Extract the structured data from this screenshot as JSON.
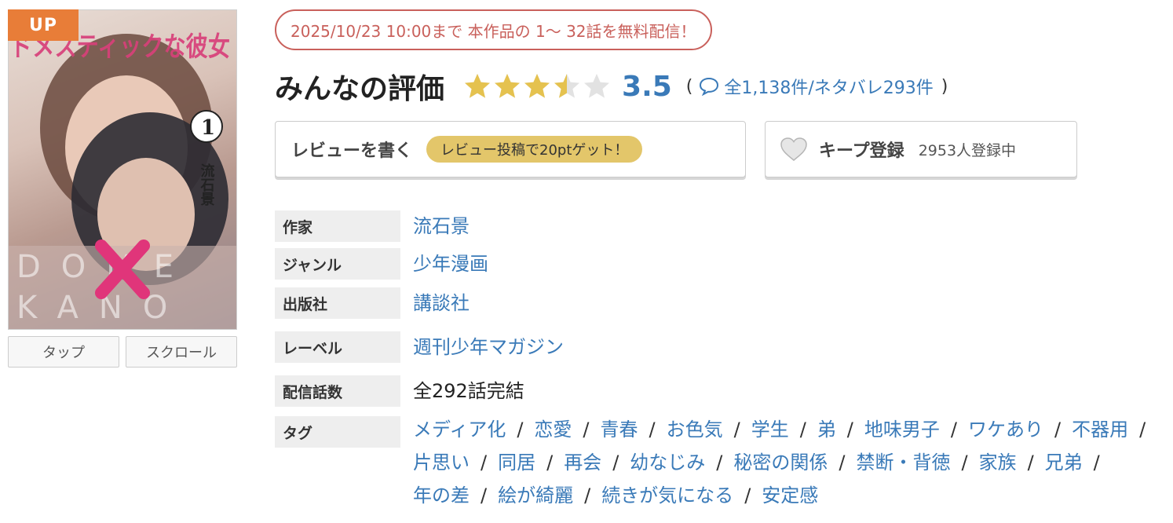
{
  "cover": {
    "badge": "UP",
    "title_art": "ドメスティックな彼女",
    "volume": "1",
    "author_art": "流石景",
    "logo_line1": "DOME",
    "logo_line2": "KANO"
  },
  "view_buttons": {
    "tap": "タップ",
    "scroll": "スクロール"
  },
  "notice": "2025/10/23 10:00まで 本作品の 1〜 32話を無料配信！",
  "rating": {
    "title": "みんなの評価",
    "score": "3.5",
    "score_value": 3.5,
    "star_max": 5,
    "open_paren": "(",
    "close_paren": ")",
    "review_counts": "全1,138件/ネタバレ293件",
    "icon": "speech-bubble-icon",
    "star_color": "#e5c24f",
    "score_color": "#3a7ab8"
  },
  "review_button": {
    "label": "レビューを書く",
    "promo": "レビュー投稿で20ptゲット！"
  },
  "keep_button": {
    "icon": "heart-icon",
    "label": "キープ登録",
    "count": "2953人登録中"
  },
  "details": {
    "author": {
      "label": "作家",
      "value": "流石景"
    },
    "genre": {
      "label": "ジャンル",
      "value": "少年漫画"
    },
    "publisher": {
      "label": "出版社",
      "value": "講談社"
    },
    "imprint": {
      "label": "レーベル",
      "value": "週刊少年マガジン"
    },
    "episodes": {
      "label": "配信話数",
      "value": "全292話完結"
    },
    "tags": {
      "label": "タグ",
      "separator": "/",
      "items": [
        "メディア化",
        "恋愛",
        "青春",
        "お色気",
        "学生",
        "弟",
        "地味男子",
        "ワケあり",
        "不器用",
        "片思い",
        "同居",
        "再会",
        "幼なじみ",
        "秘密の関係",
        "禁断・背徳",
        "家族",
        "兄弟",
        "年の差",
        "絵が綺麗",
        "続きが気になる",
        "安定感"
      ]
    }
  },
  "colors": {
    "link": "#3a7ab8",
    "notice": "#c9605b",
    "badge": "#e87d38",
    "promo": "#e3c66a"
  }
}
